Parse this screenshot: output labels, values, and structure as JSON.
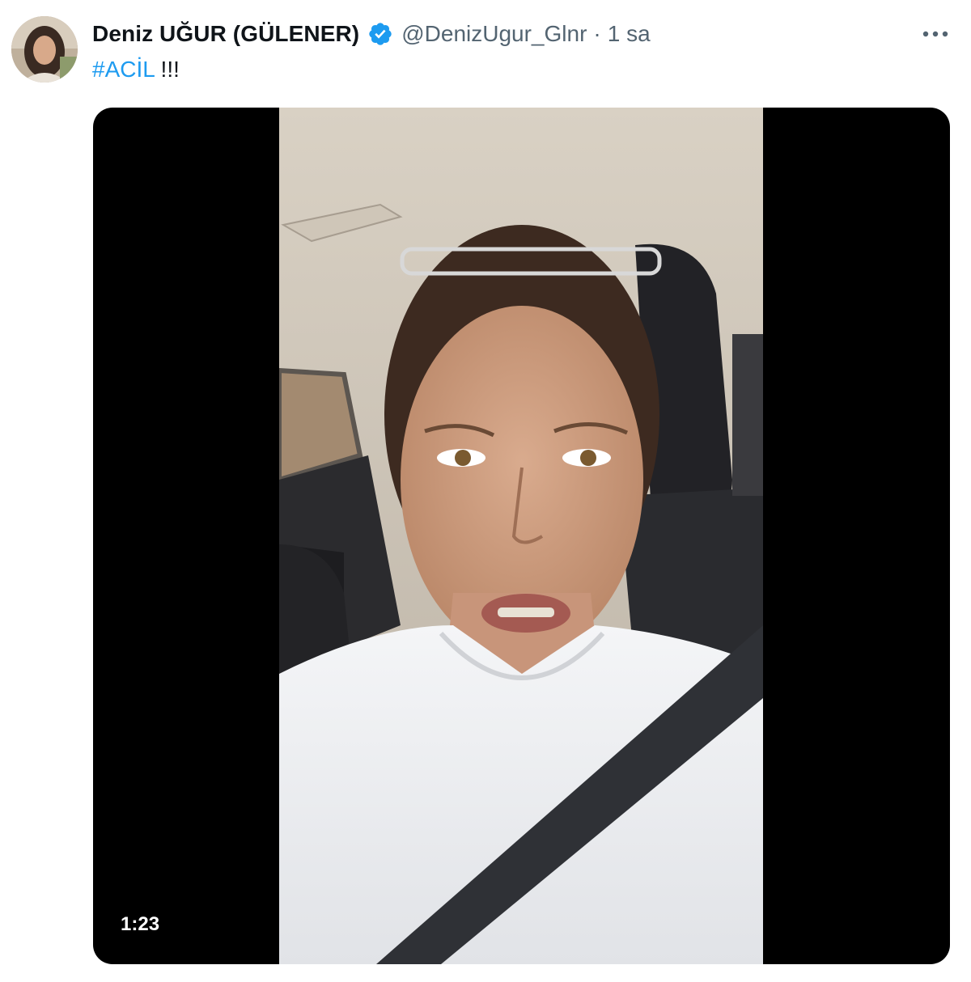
{
  "author": {
    "display_name": "Deniz UĞUR (GÜLENER)",
    "handle": "@DenizUgur_Glnr",
    "verified": true,
    "avatar_icon": "profile-photo"
  },
  "meta": {
    "separator": "·",
    "time": "1 sa"
  },
  "tweet": {
    "hashtag": "#ACİL",
    "suffix": " !!!"
  },
  "media": {
    "type": "video",
    "duration": "1:23"
  },
  "colors": {
    "hashtag": "#1d9bf0",
    "verified_badge": "#1d9bf0",
    "secondary_text": "#536471",
    "primary_text": "#0f1419",
    "media_background": "#000000"
  },
  "icons": {
    "verified": "verified-badge-icon",
    "more": "more-dots-icon"
  }
}
